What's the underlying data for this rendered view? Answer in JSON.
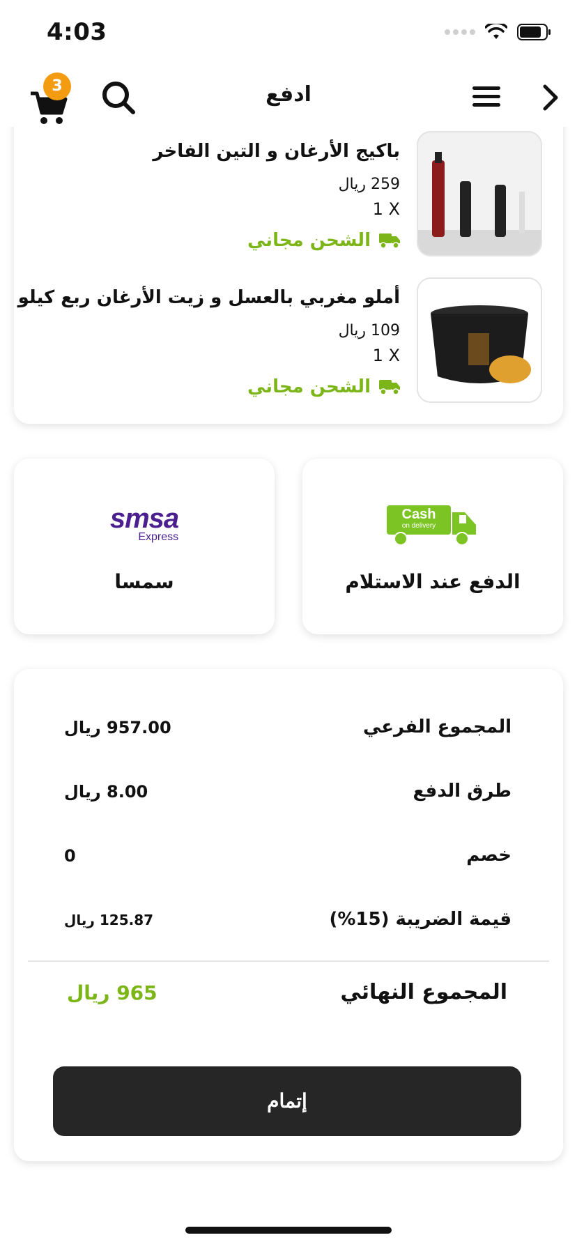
{
  "status_bar": {
    "time": "4:03"
  },
  "header": {
    "title": "ادفع",
    "cart_count": "3"
  },
  "products": [
    {
      "name": "باكيج الأرغان و التين الفاخر",
      "price": "259 ريال",
      "qty": "1 X",
      "shipping": "الشحن مجاني"
    },
    {
      "name": "أملو مغربي بالعسل  و زيت الأرغان ربع كيلو",
      "price": "109 ريال",
      "qty": "1 X",
      "shipping": "الشحن مجاني"
    }
  ],
  "payment_options": {
    "cod": {
      "label": "الدفع عند الاستلام",
      "logo_line1": "Cash",
      "logo_line2": "on delivery"
    },
    "smsa": {
      "label": "سمسا",
      "logo_main": "smsa",
      "logo_sub": "Express"
    }
  },
  "summary": {
    "subtotal_label": "المجموع الفرعي",
    "subtotal_value": "957.00 ريال",
    "payment_label": "طرق الدفع",
    "payment_value": "8.00 ريال",
    "discount_label": "خصم",
    "discount_value": "0",
    "tax_label": "قيمة الضريبة (15%)",
    "tax_value": "125.87 ريال",
    "total_label": "المجموع النهائي",
    "total_value": "965 ريال"
  },
  "complete_button": "إتمام",
  "colors": {
    "accent_green": "#7cb518",
    "badge_orange": "#f39c12",
    "button_dark": "#262626"
  }
}
